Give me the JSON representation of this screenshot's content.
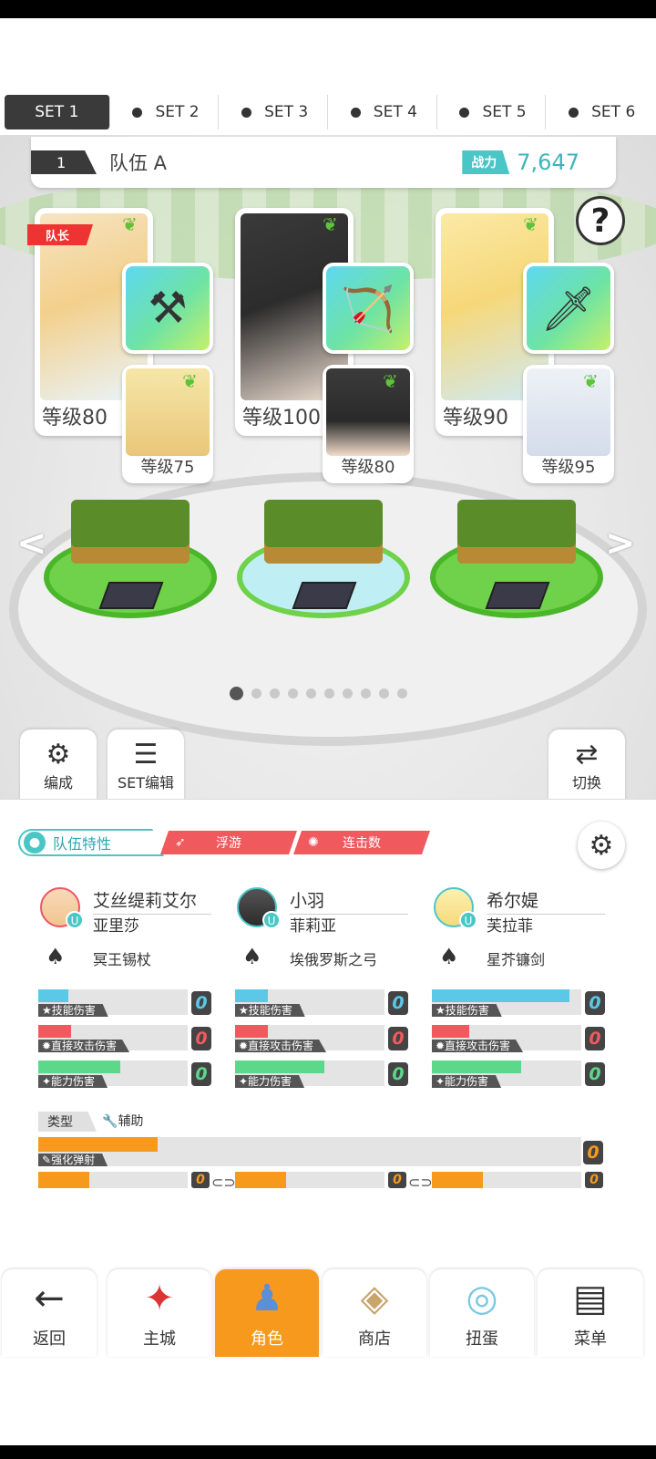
{
  "set_tabs": [
    {
      "label": "SET 1",
      "active": true
    },
    {
      "label": "SET 2"
    },
    {
      "label": "SET 3"
    },
    {
      "label": "SET 4"
    },
    {
      "label": "SET 5"
    },
    {
      "label": "SET 6"
    }
  ],
  "team": {
    "number": "1",
    "name": "队伍 A",
    "power_label": "战力",
    "power_value": "7,647"
  },
  "help_label": "?",
  "captain_label": "队长",
  "heroes": [
    {
      "level": "等级80",
      "sub_level": "等级75",
      "weapon_icon": "⚒"
    },
    {
      "level": "等级100",
      "sub_level": "等级80",
      "weapon_icon": "🏹"
    },
    {
      "level": "等级90",
      "sub_level": "等级95",
      "weapon_icon": "🗡"
    }
  ],
  "pager": {
    "total": 10,
    "active": 1
  },
  "side_buttons": {
    "formation": "编成",
    "set_edit": "SET编辑",
    "switch": "切换"
  },
  "traits": {
    "main": "队伍特性",
    "tag1": "浮游",
    "tag2": "连击数"
  },
  "members": [
    {
      "name": "艾丝缇莉艾尔",
      "sub": "亚里莎",
      "weapon": "冥王锡杖",
      "stats": [
        {
          "label": "★技能伤害",
          "value": "0",
          "fill": 0.2
        },
        {
          "label": "✹直接攻击伤害",
          "value": "0",
          "fill": 0.22
        },
        {
          "label": "✦能力伤害",
          "value": "0",
          "fill": 0.55
        }
      ]
    },
    {
      "name": "小羽",
      "sub": "菲莉亚",
      "weapon": "埃俄罗斯之弓",
      "stats": [
        {
          "label": "★技能伤害",
          "value": "0",
          "fill": 0.22
        },
        {
          "label": "✹直接攻击伤害",
          "value": "0",
          "fill": 0.22
        },
        {
          "label": "✦能力伤害",
          "value": "0",
          "fill": 0.6
        }
      ]
    },
    {
      "name": "希尔媞",
      "sub": "芙拉菲",
      "weapon": "星芥镰剑",
      "stats": [
        {
          "label": "★技能伤害",
          "value": "0",
          "fill": 0.92
        },
        {
          "label": "✹直接攻击伤害",
          "value": "0",
          "fill": 0.25
        },
        {
          "label": "✦能力伤害",
          "value": "0",
          "fill": 0.6
        }
      ]
    }
  ],
  "type_row": {
    "label": "类型",
    "value": "辅助"
  },
  "chain": {
    "label": "强化弹射",
    "value": "0",
    "fill": 0.22,
    "segments": [
      {
        "value": "0",
        "fill": 0.34
      },
      {
        "value": "0",
        "fill": 0.34
      },
      {
        "value": "0",
        "fill": 0.34
      }
    ]
  },
  "colors": {
    "skill": "#5cc8e8",
    "attack": "#f05a5f",
    "ability": "#5dd88a",
    "accent": "#f7991c",
    "teal": "#4bc6c6"
  },
  "nav": [
    {
      "label": "返回",
      "icon": "arrow-left-icon"
    },
    {
      "label": "主城",
      "icon": "town-icon"
    },
    {
      "label": "角色",
      "icon": "character-icon",
      "active": true
    },
    {
      "label": "商店",
      "icon": "shop-icon"
    },
    {
      "label": "扭蛋",
      "icon": "gacha-icon"
    },
    {
      "label": "菜单",
      "icon": "menu-icon"
    }
  ]
}
